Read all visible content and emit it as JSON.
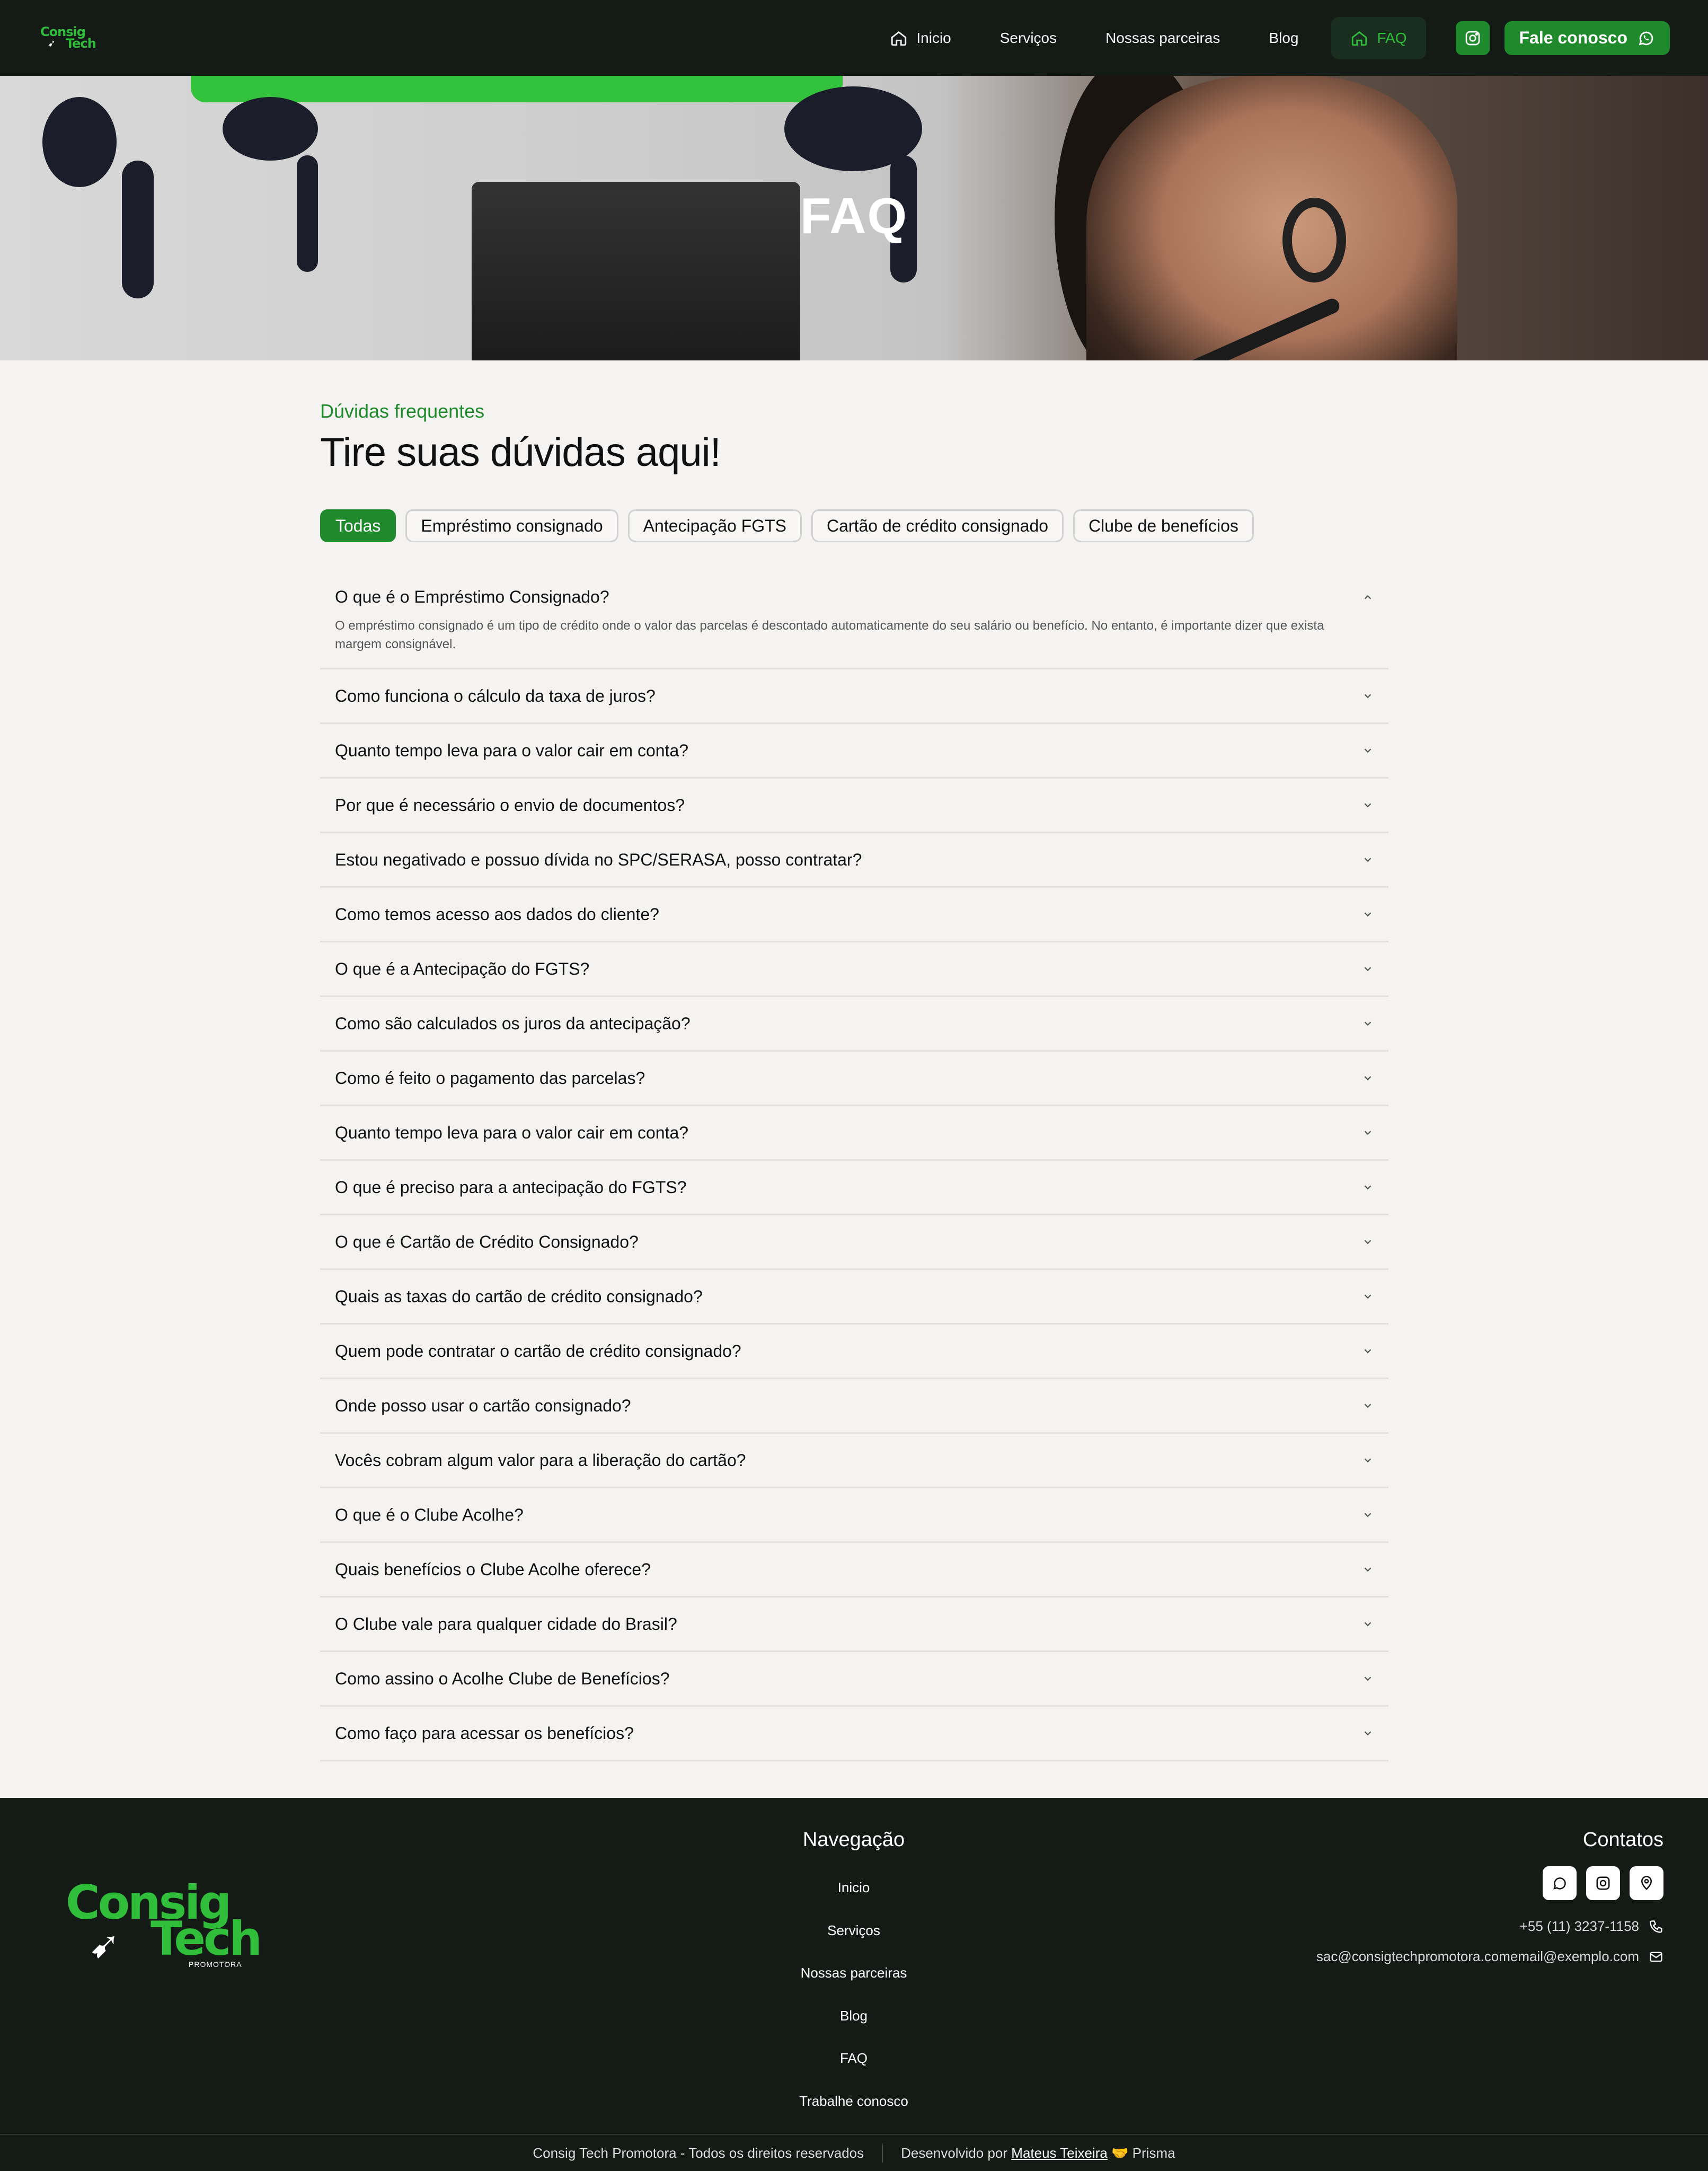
{
  "nav": {
    "logo_line1": "Consig",
    "logo_line2": "Tech",
    "items": [
      {
        "label": "Inicio",
        "icon": "home-icon"
      },
      {
        "label": "Serviços"
      },
      {
        "label": "Nossas parceiras"
      },
      {
        "label": "Blog"
      },
      {
        "label": "FAQ",
        "icon": "home-icon",
        "active": true
      }
    ],
    "instagram_icon": "instagram-icon",
    "cta_label": "Fale conosco",
    "cta_icon": "whatsapp-icon"
  },
  "hero": {
    "title": "FAQ"
  },
  "faq": {
    "eyebrow": "Dúvidas frequentes",
    "heading": "Tire suas dúvidas aqui!",
    "filters": [
      {
        "label": "Todas",
        "active": true
      },
      {
        "label": "Empréstimo consignado"
      },
      {
        "label": "Antecipação FGTS"
      },
      {
        "label": "Cartão de crédito consignado"
      },
      {
        "label": "Clube de benefícios"
      }
    ],
    "questions": [
      {
        "q": "O que é o Empréstimo Consignado?",
        "open": true,
        "a": "O empréstimo consignado é um tipo de crédito onde o valor das parcelas é descontado automaticamente do seu salário ou benefício. No entanto, é importante dizer que exista margem consignável."
      },
      {
        "q": "Como funciona o cálculo da taxa de juros?"
      },
      {
        "q": "Quanto tempo leva para o valor cair em conta?"
      },
      {
        "q": "Por que é necessário o envio de documentos?"
      },
      {
        "q": "Estou negativado e possuo dívida no SPC/SERASA, posso contratar?"
      },
      {
        "q": "Como temos acesso aos dados do cliente?"
      },
      {
        "q": "O que é a Antecipação do FGTS?"
      },
      {
        "q": "Como são calculados os juros da antecipação?"
      },
      {
        "q": "Como é feito o pagamento das parcelas?"
      },
      {
        "q": "Quanto tempo leva para o valor cair em conta?"
      },
      {
        "q": "O que é preciso para a antecipação do FGTS?"
      },
      {
        "q": "O que é Cartão de Crédito Consignado?"
      },
      {
        "q": "Quais as taxas do cartão de crédito consignado?"
      },
      {
        "q": "Quem pode contratar o cartão de crédito consignado?"
      },
      {
        "q": "Onde posso usar o cartão consignado?"
      },
      {
        "q": "Vocês cobram algum valor para a liberação do cartão?"
      },
      {
        "q": "O que é o Clube Acolhe?"
      },
      {
        "q": "Quais benefícios o Clube Acolhe oferece?"
      },
      {
        "q": "O Clube vale para qualquer cidade do Brasil?"
      },
      {
        "q": "Como assino o Acolhe Clube de Benefícios?"
      },
      {
        "q": "Como faço para acessar os benefícios?"
      }
    ]
  },
  "footer": {
    "logo_line1": "Consig",
    "logo_line2": "Tech",
    "logo_sub": "PROMOTORA",
    "nav_title": "Navegação",
    "nav_items": [
      "Inicio",
      "Serviços",
      "Nossas parceiras",
      "Blog",
      "FAQ",
      "Trabalhe conosco"
    ],
    "contacts_title": "Contatos",
    "social_icons": [
      "whatsapp-icon",
      "instagram-icon",
      "location-pin-icon"
    ],
    "phone": "+55 (11) 3237-1158",
    "email": "sac@consigtechpromotora.comemail@exemplo.com",
    "copyright": "Consig Tech Promotora - Todos os direitos reservados",
    "dev_prefix": "Desenvolvido por",
    "dev_name": "Mateus Teixeira",
    "dev_suffix": "Prisma"
  }
}
